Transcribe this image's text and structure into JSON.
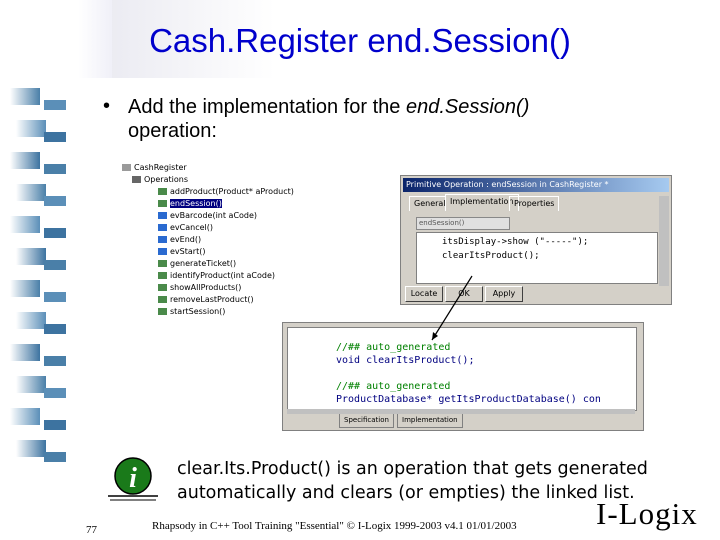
{
  "slide": {
    "title": "Cash.Register end.Session()",
    "bullet_marker": "•",
    "bullet_text_prefix": "Add the implementation for the ",
    "bullet_text_italic": "end.Session()",
    "bullet_text_suffix": " operation:",
    "note": "clear.Its.Product() is an operation that gets generated automatically and clears (or empties) the linked list.",
    "page_number": "77",
    "footer": "Rhapsody in C++ Tool Training \"Essential\"  © I-Logix 1999-2003   v4.1  01/01/2003",
    "logo": "I-Logix"
  },
  "tree": {
    "root": "CashRegister",
    "group": "Operations",
    "items": [
      "addProduct(Product* aProduct)",
      "endSession()",
      "evBarcode(int aCode)",
      "evCancel()",
      "evEnd()",
      "evStart()",
      "generateTicket()",
      "identifyProduct(int aCode)",
      "showAllProducts()",
      "removeLastProduct()",
      "startSession()"
    ],
    "selected_index": 1
  },
  "dialog": {
    "title": "Primitive Operation : endSession in CashRegister *",
    "tabs": [
      "General",
      "Implementation",
      "Properties"
    ],
    "active_tab": 1,
    "field_value": "endSession()",
    "code": [
      "itsDisplay->show (\"-----\");",
      "clearItsProduct();"
    ],
    "buttons": [
      "Locate",
      "OK",
      "Apply"
    ]
  },
  "editor": {
    "lines": [
      {
        "text": "//## auto_generated",
        "kind": "comment"
      },
      {
        "text": "void clearItsProduct();",
        "kind": "code"
      },
      {
        "text": "",
        "kind": "code"
      },
      {
        "text": "//## auto_generated",
        "kind": "comment"
      },
      {
        "text": "ProductDatabase* getItsProductDatabase() con",
        "kind": "code"
      }
    ],
    "tabs": [
      "Specification",
      "Implementation"
    ]
  },
  "colors": {
    "title": "#0000cc",
    "strip_squares": [
      "#4a7fa8",
      "#5b8fb8",
      "#3d73a0"
    ]
  }
}
